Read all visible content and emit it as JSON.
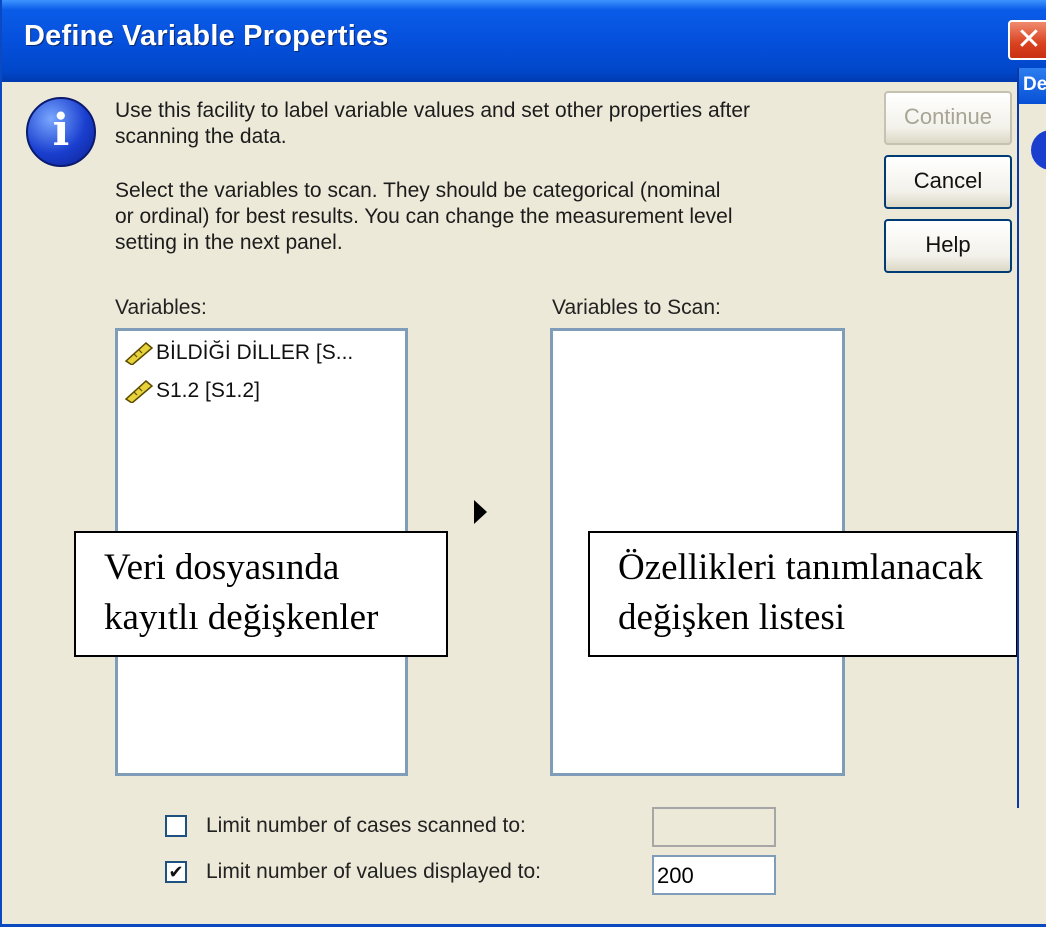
{
  "window": {
    "title": "Define Variable Properties",
    "close_glyph": "✕"
  },
  "info": {
    "icon_glyph": "i",
    "line1": "Use this facility to label variable values and set other properties after",
    "line2": "scanning the data.",
    "line3": "Select the variables to scan.  They should be categorical (nominal",
    "line4": "or ordinal) for best results.  You can change the  measurement level",
    "line5": "setting in the next panel."
  },
  "buttons": {
    "continue": "Continue",
    "cancel": "Cancel",
    "help": "Help"
  },
  "variables": {
    "label": "Variables:",
    "items": [
      {
        "name": "BİLDİĞİ DİLLER [S...",
        "icon": "scale-ruler-icon"
      },
      {
        "name": "S1.2 [S1.2]",
        "icon": "scale-ruler-icon"
      }
    ]
  },
  "scan": {
    "label": "Variables to Scan:",
    "move_icon": "right-arrow-icon"
  },
  "annotations": {
    "left_line1": "Veri dosyasında",
    "left_line2": "kayıtlı değişkenler",
    "right_line1": "Özellikleri tanımlanacak",
    "right_line2": "değişken listesi"
  },
  "options": {
    "limit_cases_label": "Limit number of cases scanned to:",
    "limit_cases_checked": false,
    "limit_cases_value": "",
    "limit_values_label": "Limit number of values displayed to:",
    "limit_values_checked": true,
    "limit_values_value": "200",
    "check_glyph": "✔"
  },
  "background_dialog": {
    "title_fragment": "De"
  },
  "colors": {
    "titlebar": "#0550dc",
    "dialog_bg": "#ece9d8",
    "listbox_border": "#7f9db9",
    "close_button": "#d9411f"
  }
}
